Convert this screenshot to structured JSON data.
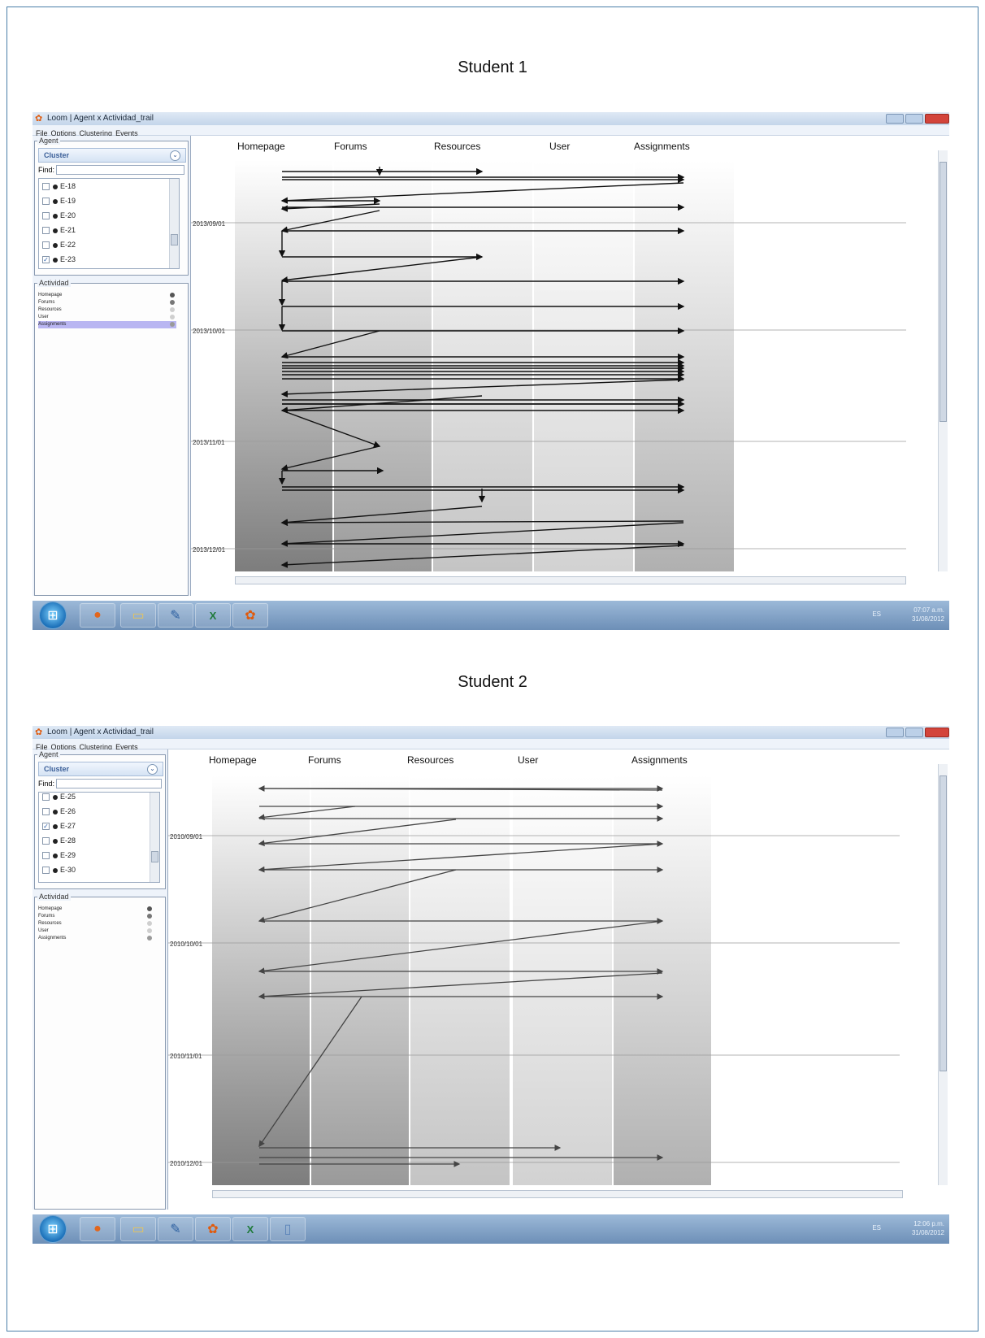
{
  "figure": {
    "captions": [
      "Student 1",
      "Student 2"
    ]
  },
  "app": {
    "title": "Loom | Agent x Actividad_trail",
    "menu": [
      "File",
      "Options",
      "Clustering",
      "Events"
    ],
    "agent_group_label": "Agent",
    "cluster_label": "Cluster",
    "find_label": "Find:",
    "activity_group_label": "Actividad",
    "activities": [
      "Homepage",
      "Forums",
      "Resources",
      "User",
      "Assignments"
    ],
    "activity_colors": [
      "#555555",
      "#777777",
      "#cfcfcf",
      "#cfcfcf",
      "#9a9a9a"
    ],
    "column_headers": [
      "Homepage",
      "Forums",
      "Resources",
      "User",
      "Assignments"
    ]
  },
  "screens": [
    {
      "agents": [
        {
          "label": "E-18",
          "checked": false
        },
        {
          "label": "E-19",
          "checked": false
        },
        {
          "label": "E-20",
          "checked": false
        },
        {
          "label": "E-21",
          "checked": false
        },
        {
          "label": "E-22",
          "checked": false
        },
        {
          "label": "E-23",
          "checked": true
        }
      ],
      "highlighted_activity": "Assignments",
      "date_labels": [
        "2013/09/01",
        "2013/10/01",
        "2013/11/01",
        "2013/12/01"
      ],
      "tray": {
        "lang": "ES",
        "time": "07:07 a.m.",
        "date": "31/08/2012"
      },
      "taskbar_icons": [
        "start-orb",
        "firefox",
        "explorer",
        "notes",
        "excel",
        "loom"
      ]
    },
    {
      "agents": [
        {
          "label": "E-25",
          "checked": false
        },
        {
          "label": "E-26",
          "checked": false
        },
        {
          "label": "E-27",
          "checked": true
        },
        {
          "label": "E-28",
          "checked": false
        },
        {
          "label": "E-29",
          "checked": false
        },
        {
          "label": "E-30",
          "checked": false
        }
      ],
      "highlighted_activity": "",
      "date_labels": [
        "2010/09/01",
        "2010/10/01",
        "2010/11/01",
        "2010/12/01"
      ],
      "tray": {
        "lang": "ES",
        "time": "12:06 p.m.",
        "date": "31/08/2012"
      },
      "taskbar_icons": [
        "start-orb",
        "firefox",
        "explorer",
        "notes",
        "loom",
        "excel",
        "document"
      ]
    }
  ]
}
